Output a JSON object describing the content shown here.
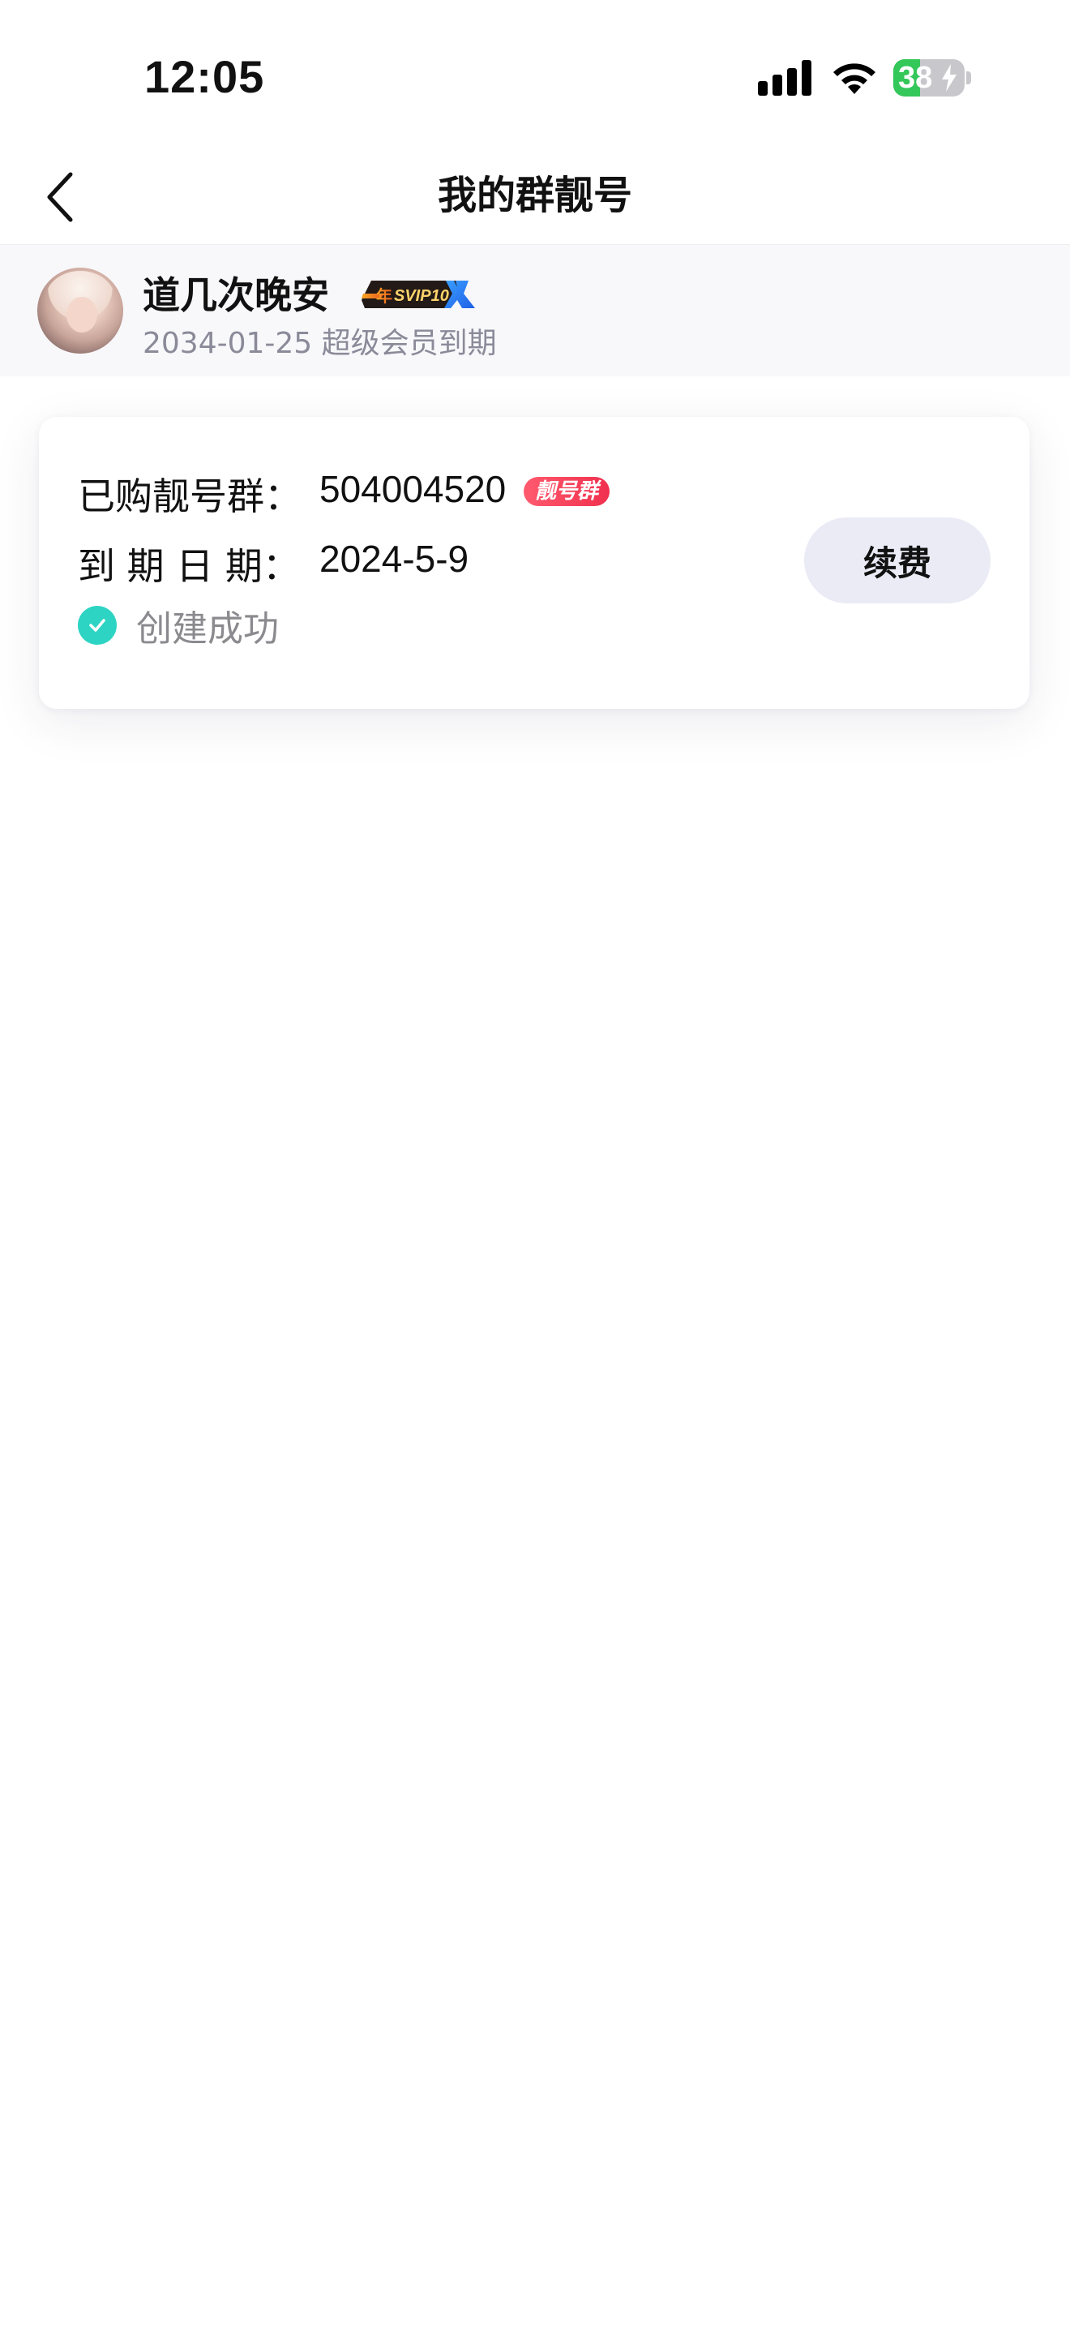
{
  "status_bar": {
    "time": "12:05",
    "battery_percent": "38",
    "battery_level": 0.38,
    "icons": [
      "signal-icon",
      "wifi-icon",
      "battery-icon"
    ]
  },
  "nav": {
    "title": "我的群靓号",
    "back_icon": "chevron-left-icon"
  },
  "user": {
    "name": "道几次晚安",
    "badge": "SVIP10",
    "badge_prefix": "年",
    "member_expiry": "2034-01-25 超级会员到期"
  },
  "card": {
    "purchased_label": "已购靓号群：",
    "group_number": "504004520",
    "group_tag": "靓号群",
    "expiry_label": "到 期 日 期：",
    "expiry_date": "2024-5-9",
    "status_text": "创建成功",
    "renew_label": "续费"
  },
  "colors": {
    "accent_teal": "#2dd4c4",
    "tag_red": "#f0304e",
    "renew_bg": "#ebebf6",
    "header_bg": "#f8f8fb"
  }
}
